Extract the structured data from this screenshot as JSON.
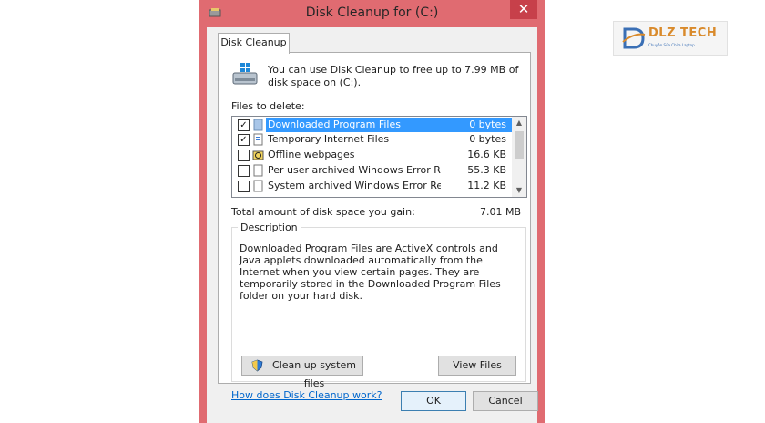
{
  "window": {
    "title": "Disk Cleanup for  (C:)",
    "close_glyph": "✕"
  },
  "tab": {
    "label": "Disk Cleanup"
  },
  "intro": "You can use Disk Cleanup to free up to 7.99 MB of disk space on  (C:).",
  "files_label": "Files to delete:",
  "files": [
    {
      "name": "Downloaded Program Files",
      "size": "0 bytes",
      "checked": true,
      "selected": true,
      "icon": "folder-icon"
    },
    {
      "name": "Temporary Internet Files",
      "size": "0 bytes",
      "checked": true,
      "selected": false,
      "icon": "document-icon"
    },
    {
      "name": "Offline webpages",
      "size": "16.6 KB",
      "checked": false,
      "selected": false,
      "icon": "offline-icon"
    },
    {
      "name": "Per user archived Windows Error Repo...",
      "size": "55.3 KB",
      "checked": false,
      "selected": false,
      "icon": "file-icon"
    },
    {
      "name": "System archived Windows Error Repor...",
      "size": "11.2 KB",
      "checked": false,
      "selected": false,
      "icon": "file-icon"
    }
  ],
  "total_label": "Total amount of disk space you gain:",
  "total_value": "7.01 MB",
  "description": {
    "legend": "Description",
    "text": "Downloaded Program Files are ActiveX controls and Java applets downloaded automatically from the Internet when you view certain pages. They are temporarily stored in the Downloaded Program Files folder on your hard disk."
  },
  "buttons": {
    "cleanup_system": "Clean up system files",
    "view_files": "View Files",
    "ok": "OK",
    "cancel": "Cancel"
  },
  "help_link": "How does Disk Cleanup work?",
  "logo": {
    "text": "DLZ TECH",
    "sub": "Chuyên Sửa Chữa Laptop"
  },
  "colors": {
    "frame": "#e06b71",
    "close": "#c7404a",
    "selection": "#3399ff",
    "link": "#0066cc",
    "logo": "#d98a2b"
  }
}
